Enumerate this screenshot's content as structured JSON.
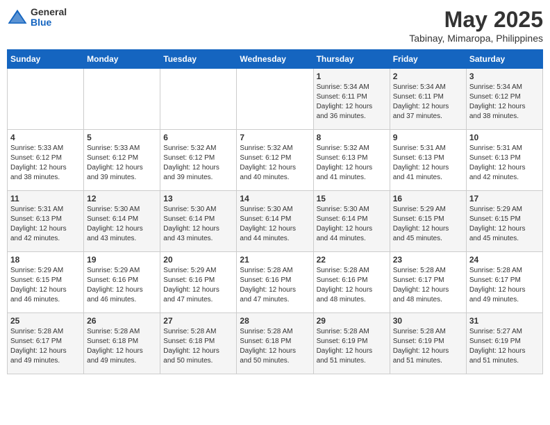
{
  "logo": {
    "general": "General",
    "blue": "Blue"
  },
  "header": {
    "month_year": "May 2025",
    "location": "Tabinay, Mimaropa, Philippines"
  },
  "weekdays": [
    "Sunday",
    "Monday",
    "Tuesday",
    "Wednesday",
    "Thursday",
    "Friday",
    "Saturday"
  ],
  "weeks": [
    [
      {
        "day": "",
        "info": ""
      },
      {
        "day": "",
        "info": ""
      },
      {
        "day": "",
        "info": ""
      },
      {
        "day": "",
        "info": ""
      },
      {
        "day": "1",
        "info": "Sunrise: 5:34 AM\nSunset: 6:11 PM\nDaylight: 12 hours\nand 36 minutes."
      },
      {
        "day": "2",
        "info": "Sunrise: 5:34 AM\nSunset: 6:11 PM\nDaylight: 12 hours\nand 37 minutes."
      },
      {
        "day": "3",
        "info": "Sunrise: 5:34 AM\nSunset: 6:12 PM\nDaylight: 12 hours\nand 38 minutes."
      }
    ],
    [
      {
        "day": "4",
        "info": "Sunrise: 5:33 AM\nSunset: 6:12 PM\nDaylight: 12 hours\nand 38 minutes."
      },
      {
        "day": "5",
        "info": "Sunrise: 5:33 AM\nSunset: 6:12 PM\nDaylight: 12 hours\nand 39 minutes."
      },
      {
        "day": "6",
        "info": "Sunrise: 5:32 AM\nSunset: 6:12 PM\nDaylight: 12 hours\nand 39 minutes."
      },
      {
        "day": "7",
        "info": "Sunrise: 5:32 AM\nSunset: 6:12 PM\nDaylight: 12 hours\nand 40 minutes."
      },
      {
        "day": "8",
        "info": "Sunrise: 5:32 AM\nSunset: 6:13 PM\nDaylight: 12 hours\nand 41 minutes."
      },
      {
        "day": "9",
        "info": "Sunrise: 5:31 AM\nSunset: 6:13 PM\nDaylight: 12 hours\nand 41 minutes."
      },
      {
        "day": "10",
        "info": "Sunrise: 5:31 AM\nSunset: 6:13 PM\nDaylight: 12 hours\nand 42 minutes."
      }
    ],
    [
      {
        "day": "11",
        "info": "Sunrise: 5:31 AM\nSunset: 6:13 PM\nDaylight: 12 hours\nand 42 minutes."
      },
      {
        "day": "12",
        "info": "Sunrise: 5:30 AM\nSunset: 6:14 PM\nDaylight: 12 hours\nand 43 minutes."
      },
      {
        "day": "13",
        "info": "Sunrise: 5:30 AM\nSunset: 6:14 PM\nDaylight: 12 hours\nand 43 minutes."
      },
      {
        "day": "14",
        "info": "Sunrise: 5:30 AM\nSunset: 6:14 PM\nDaylight: 12 hours\nand 44 minutes."
      },
      {
        "day": "15",
        "info": "Sunrise: 5:30 AM\nSunset: 6:14 PM\nDaylight: 12 hours\nand 44 minutes."
      },
      {
        "day": "16",
        "info": "Sunrise: 5:29 AM\nSunset: 6:15 PM\nDaylight: 12 hours\nand 45 minutes."
      },
      {
        "day": "17",
        "info": "Sunrise: 5:29 AM\nSunset: 6:15 PM\nDaylight: 12 hours\nand 45 minutes."
      }
    ],
    [
      {
        "day": "18",
        "info": "Sunrise: 5:29 AM\nSunset: 6:15 PM\nDaylight: 12 hours\nand 46 minutes."
      },
      {
        "day": "19",
        "info": "Sunrise: 5:29 AM\nSunset: 6:16 PM\nDaylight: 12 hours\nand 46 minutes."
      },
      {
        "day": "20",
        "info": "Sunrise: 5:29 AM\nSunset: 6:16 PM\nDaylight: 12 hours\nand 47 minutes."
      },
      {
        "day": "21",
        "info": "Sunrise: 5:28 AM\nSunset: 6:16 PM\nDaylight: 12 hours\nand 47 minutes."
      },
      {
        "day": "22",
        "info": "Sunrise: 5:28 AM\nSunset: 6:16 PM\nDaylight: 12 hours\nand 48 minutes."
      },
      {
        "day": "23",
        "info": "Sunrise: 5:28 AM\nSunset: 6:17 PM\nDaylight: 12 hours\nand 48 minutes."
      },
      {
        "day": "24",
        "info": "Sunrise: 5:28 AM\nSunset: 6:17 PM\nDaylight: 12 hours\nand 49 minutes."
      }
    ],
    [
      {
        "day": "25",
        "info": "Sunrise: 5:28 AM\nSunset: 6:17 PM\nDaylight: 12 hours\nand 49 minutes."
      },
      {
        "day": "26",
        "info": "Sunrise: 5:28 AM\nSunset: 6:18 PM\nDaylight: 12 hours\nand 49 minutes."
      },
      {
        "day": "27",
        "info": "Sunrise: 5:28 AM\nSunset: 6:18 PM\nDaylight: 12 hours\nand 50 minutes."
      },
      {
        "day": "28",
        "info": "Sunrise: 5:28 AM\nSunset: 6:18 PM\nDaylight: 12 hours\nand 50 minutes."
      },
      {
        "day": "29",
        "info": "Sunrise: 5:28 AM\nSunset: 6:19 PM\nDaylight: 12 hours\nand 51 minutes."
      },
      {
        "day": "30",
        "info": "Sunrise: 5:28 AM\nSunset: 6:19 PM\nDaylight: 12 hours\nand 51 minutes."
      },
      {
        "day": "31",
        "info": "Sunrise: 5:27 AM\nSunset: 6:19 PM\nDaylight: 12 hours\nand 51 minutes."
      }
    ]
  ]
}
